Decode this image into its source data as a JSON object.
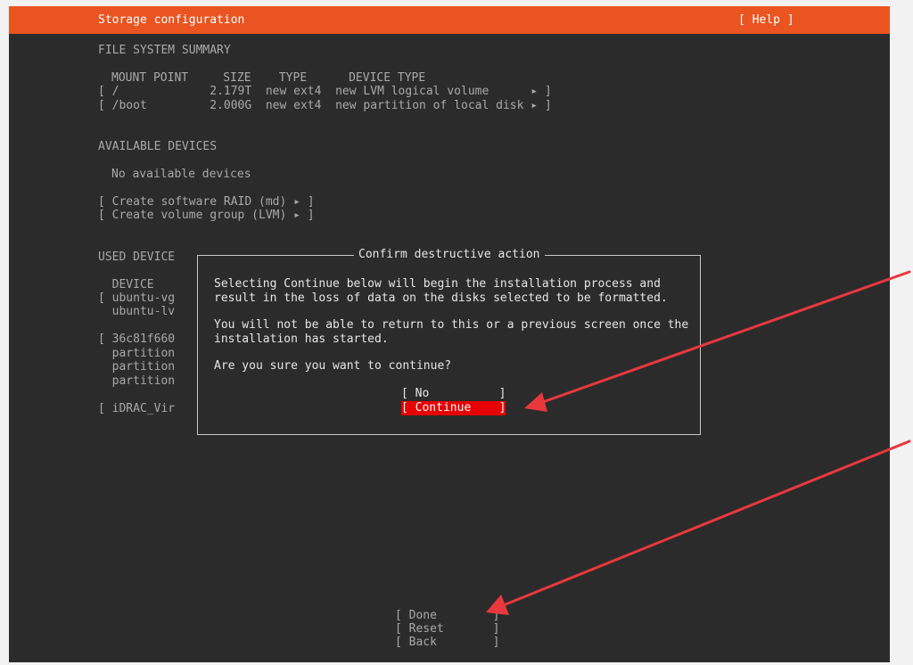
{
  "header": {
    "title": "Storage configuration",
    "help": "[ Help ]"
  },
  "fs_summary": {
    "heading": "FILE SYSTEM SUMMARY",
    "columns": "MOUNT POINT     SIZE    TYPE      DEVICE TYPE",
    "rows": [
      "[ /             2.179T  new ext4  new LVM logical volume      ▸ ]",
      "[ /boot         2.000G  new ext4  new partition of local disk ▸ ]"
    ]
  },
  "available": {
    "heading": "AVAILABLE DEVICES",
    "empty": "No available devices",
    "create_raid": "[ Create software RAID (md) ▸ ]",
    "create_vg": "[ Create volume group (LVM) ▸ ]"
  },
  "used": {
    "heading": "USED DEVICE",
    "lines": [
      "  DEVICE",
      "[ ubuntu-vg",
      "  ubuntu-lv",
      "",
      "[ 36c81f660",
      "  partition",
      "  partition",
      "  partition",
      "",
      "[ iDRAC_Vir"
    ]
  },
  "dialog": {
    "title": "Confirm destructive action",
    "paragraph1": "Selecting Continue below will begin the installation process and\nresult in the loss of data on the disks selected to be formatted.",
    "paragraph2": "You will not be able to return to this or a previous screen once the\ninstallation has started.",
    "question": "Are you sure you want to continue?",
    "no_button": "[ No          ]",
    "continue_button": "[ Continue    ]"
  },
  "footer": {
    "done": "[ Done        ]",
    "reset": "[ Reset       ]",
    "back": "[ Back        ]"
  },
  "colors": {
    "accent": "#e95420",
    "background": "#2b2b2b",
    "selected_button": "#e60000",
    "annotation_arrow": "#e8383d"
  }
}
